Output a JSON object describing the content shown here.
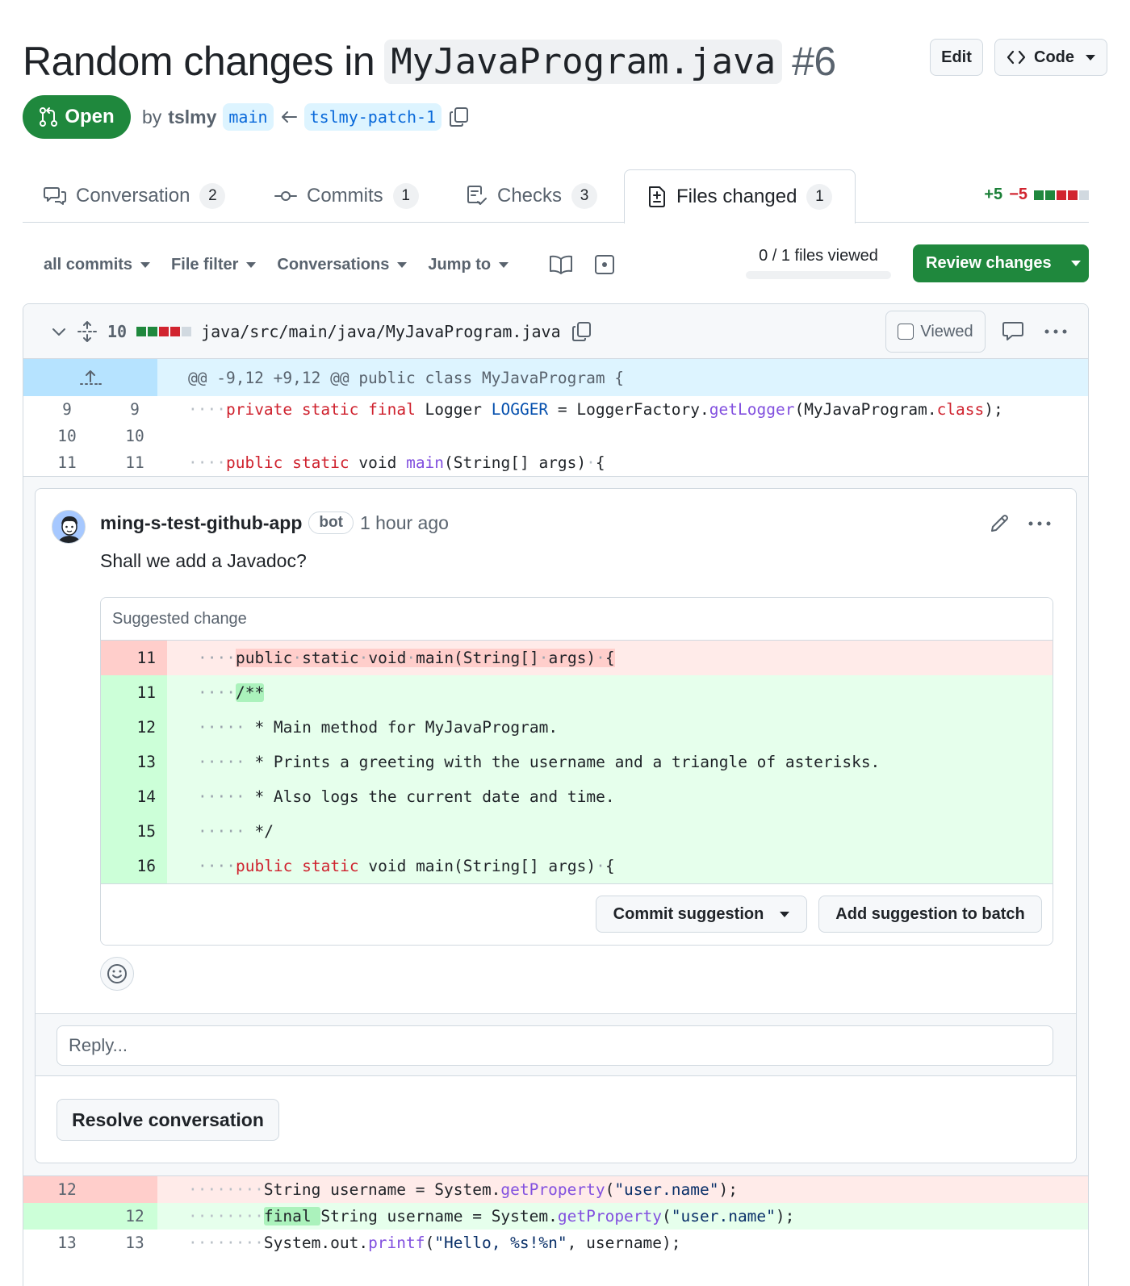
{
  "header": {
    "title_prefix": "Random changes in",
    "title_code": "MyJavaProgram.java",
    "pr_number": "#6",
    "edit_label": "Edit",
    "code_label": "Code"
  },
  "meta": {
    "state": "Open",
    "by": "by",
    "author": "tslmy",
    "base_branch": "main",
    "head_branch": "tslmy-patch-1"
  },
  "tabs": [
    {
      "label": "Conversation",
      "count": "2"
    },
    {
      "label": "Commits",
      "count": "1"
    },
    {
      "label": "Checks",
      "count": "3"
    },
    {
      "label": "Files changed",
      "count": "1"
    }
  ],
  "diffstat": {
    "additions": "+5",
    "deletions": "−5"
  },
  "toolbar": {
    "all_commits": "all commits",
    "file_filter": "File filter",
    "conversations": "Conversations",
    "jump_to": "Jump to",
    "files_viewed": "0 / 1 files viewed",
    "review_changes": "Review changes"
  },
  "file": {
    "changes": "10",
    "path": "java/src/main/java/MyJavaProgram.java",
    "viewed_label": "Viewed",
    "hunk_header": "@@ -9,12 +9,12 @@ public class MyJavaProgram {"
  },
  "diff_top": [
    {
      "old": "9",
      "new": "9"
    },
    {
      "old": "10",
      "new": "10"
    },
    {
      "old": "11",
      "new": "11"
    }
  ],
  "comment": {
    "author": "ming-s-test-github-app",
    "badge": "bot",
    "time": "1 hour ago",
    "body": "Shall we add a Javadoc?",
    "suggest_title": "Suggested change",
    "suggest_lines": [
      {
        "num": "11",
        "text": "public static void main(String[] args) {"
      },
      {
        "num": "11",
        "text": "/**"
      },
      {
        "num": "12",
        "text": "* Main method for MyJavaProgram."
      },
      {
        "num": "13",
        "text": "* Prints a greeting with the username and a triangle of asterisks."
      },
      {
        "num": "14",
        "text": "* Also logs the current date and time."
      },
      {
        "num": "15",
        "text": "*/"
      },
      {
        "num": "16",
        "text": "public static void main(String[] args) {"
      }
    ],
    "commit_suggestion": "Commit suggestion",
    "add_to_batch": "Add suggestion to batch",
    "reply_placeholder": "Reply...",
    "resolve": "Resolve conversation"
  },
  "diff_bottom": [
    {
      "old": "12",
      "new": ""
    },
    {
      "old": "",
      "new": "12"
    },
    {
      "old": "13",
      "new": "13"
    }
  ],
  "colors": {
    "accent_green": "#1f883d",
    "link_blue": "#0969da",
    "deletion_red": "#d1242f"
  }
}
